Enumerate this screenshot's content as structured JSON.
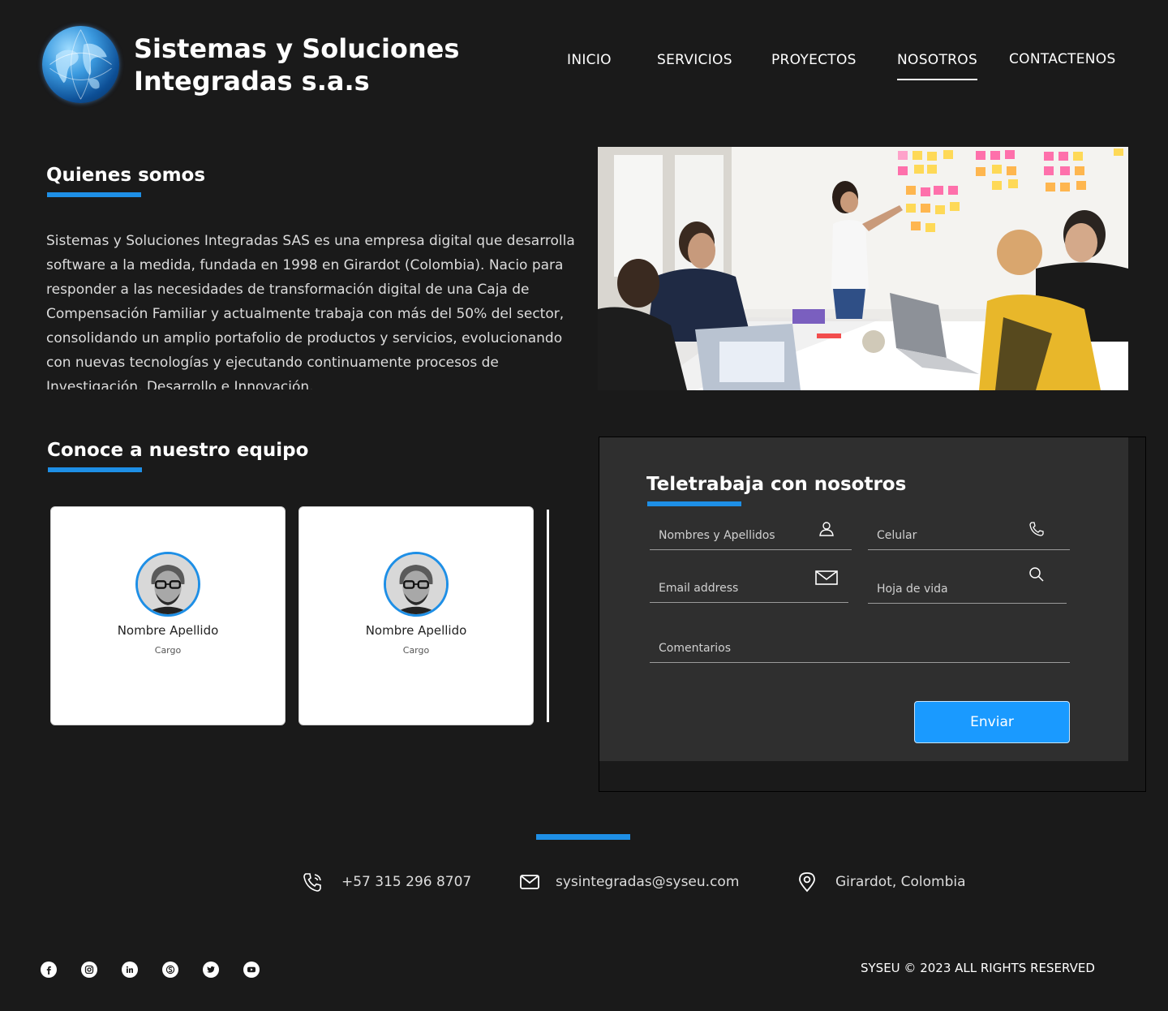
{
  "brand": {
    "name_line1": "Sistemas y Soluciones",
    "name_line2": "Integradas s.a.s",
    "logo_icon": "globe-icon"
  },
  "nav": {
    "items": [
      {
        "label": "INICIO",
        "active": false
      },
      {
        "label": "SERVICIOS",
        "active": false
      },
      {
        "label": "PROYECTOS",
        "active": false
      },
      {
        "label": "NOSOTROS",
        "active": true
      },
      {
        "label": "CONTACTENOS",
        "active": false
      }
    ]
  },
  "about": {
    "title": "Quienes somos",
    "text": "Sistemas y Soluciones Integradas SAS es una empresa digital que desarrolla software a la medida, fundada en 1998 en Girardot (Colombia). Nacio para responder a las necesidades de transformación digital de una Caja de Compensación Familiar y actualmente trabaja con más del 50% del sector, consolidando un amplio portafolio de productos y servicios, evolucionando con nuevas tecnologías y ejecutando continuamente procesos de Investigación, Desarrollo e Innovación."
  },
  "team": {
    "title": "Conoce a nuestro equipo",
    "members": [
      {
        "name": "Nombre Apellido",
        "role": "Cargo"
      },
      {
        "name": "Nombre Apellido",
        "role": "Cargo"
      }
    ]
  },
  "form": {
    "title": "Teletrabaja con nosotros",
    "fields": {
      "name": {
        "label": "Nombres y Apellidos",
        "icon": "user-icon"
      },
      "phone": {
        "label": "Celular",
        "icon": "phone-icon"
      },
      "email": {
        "label": "Email address",
        "icon": "mail-icon"
      },
      "cv": {
        "label": "Hoja de vida",
        "icon": "search-icon"
      },
      "comments": {
        "label": "Comentarios"
      }
    },
    "submit_label": "Enviar"
  },
  "footer": {
    "phone": "+57 315 296 8707",
    "email": "sysintegradas@syseu.com",
    "location": "Girardot, Colombia",
    "social": [
      "facebook-icon",
      "instagram-icon",
      "linkedin-icon",
      "skype-icon",
      "twitter-icon",
      "youtube-icon"
    ],
    "copyright": "SYSEU © 2023 ALL RIGHTS RESERVED"
  },
  "colors": {
    "background": "#1a1a1a",
    "accent": "#1e8fe6",
    "button": "#1a9aff",
    "panel": "#2f2f2f"
  }
}
